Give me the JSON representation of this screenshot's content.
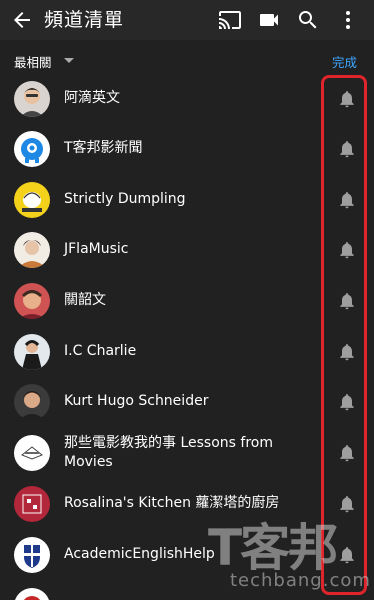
{
  "appbar": {
    "title": "頻道清單",
    "icons": [
      "back-arrow-icon",
      "cast-icon",
      "video-camera-icon",
      "search-icon",
      "more-vert-icon"
    ]
  },
  "sort": {
    "label": "最相關",
    "done_label": "完成"
  },
  "channels": [
    {
      "name": "阿滴英文"
    },
    {
      "name": "T客邦影新聞"
    },
    {
      "name": "Strictly Dumpling"
    },
    {
      "name": "JFlaMusic"
    },
    {
      "name": "關韶文"
    },
    {
      "name": "I.C Charlie"
    },
    {
      "name": "Kurt Hugo Schneider"
    },
    {
      "name": "那些電影教我的事 Lessons from Movies"
    },
    {
      "name": "Rosalina's Kitchen 蘿潔塔的廚房"
    },
    {
      "name": "AcademicEnglishHelp"
    }
  ],
  "watermark": {
    "logo": "T客邦",
    "site": "techbang.com"
  },
  "colors": {
    "background": "#212121",
    "accent": "#3ea6ff",
    "highlight": "#e0242b"
  }
}
